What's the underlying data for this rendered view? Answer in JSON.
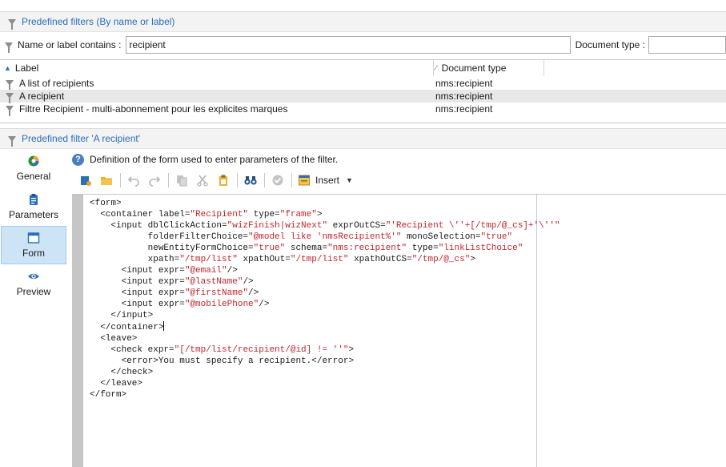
{
  "top_header": {
    "title": "Predefined filters (By name or label)"
  },
  "filter_bar": {
    "name_label": "Name or label contains :",
    "name_value": "recipient",
    "doctype_label": "Document type :",
    "doctype_value": ""
  },
  "results": {
    "columns": [
      {
        "label": "Label",
        "sort": "▲"
      },
      {
        "label": "Document type",
        "sort": "∕"
      }
    ],
    "rows": [
      {
        "label": "A list of recipients",
        "doc_type": "nms:recipient"
      },
      {
        "label": "A recipient",
        "doc_type": "nms:recipient"
      },
      {
        "label": "Filtre Recipient - multi-abonnement pour les explicites marques",
        "doc_type": "nms:recipient"
      }
    ]
  },
  "detail_header": {
    "title": "Predefined filter 'A recipient'"
  },
  "sidebar": {
    "items": [
      {
        "label": "General",
        "icon": "general-icon",
        "active": false
      },
      {
        "label": "Parameters",
        "icon": "clipboard-icon",
        "active": false
      },
      {
        "label": "Form",
        "icon": "form-window-icon",
        "active": true
      },
      {
        "label": "Preview",
        "icon": "eye-icon",
        "active": false
      }
    ]
  },
  "definition": {
    "text": "Definition of the form used to enter parameters of the filter."
  },
  "toolbar": {
    "insert_label": "Insert"
  },
  "editor": {
    "lines": [
      {
        "parts": [
          [
            "t",
            "<form>"
          ]
        ]
      },
      {
        "parts": [
          [
            "t",
            "  <container label="
          ],
          [
            "s",
            "\"Recipient\""
          ],
          [
            "t",
            " type="
          ],
          [
            "s",
            "\"frame\""
          ],
          [
            "t",
            ">"
          ]
        ]
      },
      {
        "parts": [
          [
            "t",
            "    <input dblClickAction="
          ],
          [
            "s",
            "\"wizFinish|wizNext\""
          ],
          [
            "t",
            " exprOutCS="
          ],
          [
            "s",
            "\"'Recipient \\''+[/tmp/@_cs]+'\\''\""
          ]
        ]
      },
      {
        "parts": [
          [
            "t",
            "           folderFilterChoice="
          ],
          [
            "s",
            "\"@model like 'nmsRecipient%'\""
          ],
          [
            "t",
            " monoSelection="
          ],
          [
            "s",
            "\"true\""
          ]
        ]
      },
      {
        "parts": [
          [
            "t",
            "           newEntityFormChoice="
          ],
          [
            "s",
            "\"true\""
          ],
          [
            "t",
            " schema="
          ],
          [
            "s",
            "\"nms:recipient\""
          ],
          [
            "t",
            " type="
          ],
          [
            "s",
            "\"linkListChoice\""
          ]
        ]
      },
      {
        "parts": [
          [
            "t",
            "           xpath="
          ],
          [
            "s",
            "\"/tmp/list\""
          ],
          [
            "t",
            " xpathOut="
          ],
          [
            "s",
            "\"/tmp/list\""
          ],
          [
            "t",
            " xpathOutCS="
          ],
          [
            "s",
            "\"/tmp/@_cs\""
          ],
          [
            "t",
            ">"
          ]
        ]
      },
      {
        "parts": [
          [
            "t",
            "      <input expr="
          ],
          [
            "s",
            "\"@email\""
          ],
          [
            "t",
            "/>"
          ]
        ]
      },
      {
        "parts": [
          [
            "t",
            "      <input expr="
          ],
          [
            "s",
            "\"@lastName\""
          ],
          [
            "t",
            "/>"
          ]
        ]
      },
      {
        "parts": [
          [
            "t",
            "      <input expr="
          ],
          [
            "s",
            "\"@firstName\""
          ],
          [
            "t",
            "/>"
          ]
        ]
      },
      {
        "parts": [
          [
            "t",
            "      <input expr="
          ],
          [
            "s",
            "\"@mobilePhone\""
          ],
          [
            "t",
            "/>"
          ]
        ]
      },
      {
        "parts": [
          [
            "t",
            "    </input>"
          ]
        ]
      },
      {
        "parts": [
          [
            "t",
            "  </container>"
          ]
        ],
        "caret": true
      },
      {
        "parts": [
          [
            "t",
            "  <leave>"
          ]
        ]
      },
      {
        "parts": [
          [
            "t",
            "    <check expr="
          ],
          [
            "s",
            "\"[/tmp/list/recipient/@id] != ''\""
          ],
          [
            "t",
            ">"
          ]
        ]
      },
      {
        "parts": [
          [
            "t",
            "      <error>You must specify a recipient.</error>"
          ]
        ]
      },
      {
        "parts": [
          [
            "t",
            "    </check>"
          ]
        ]
      },
      {
        "parts": [
          [
            "t",
            "  </leave>"
          ]
        ]
      },
      {
        "parts": [
          [
            "t",
            "</form>"
          ]
        ]
      }
    ]
  }
}
